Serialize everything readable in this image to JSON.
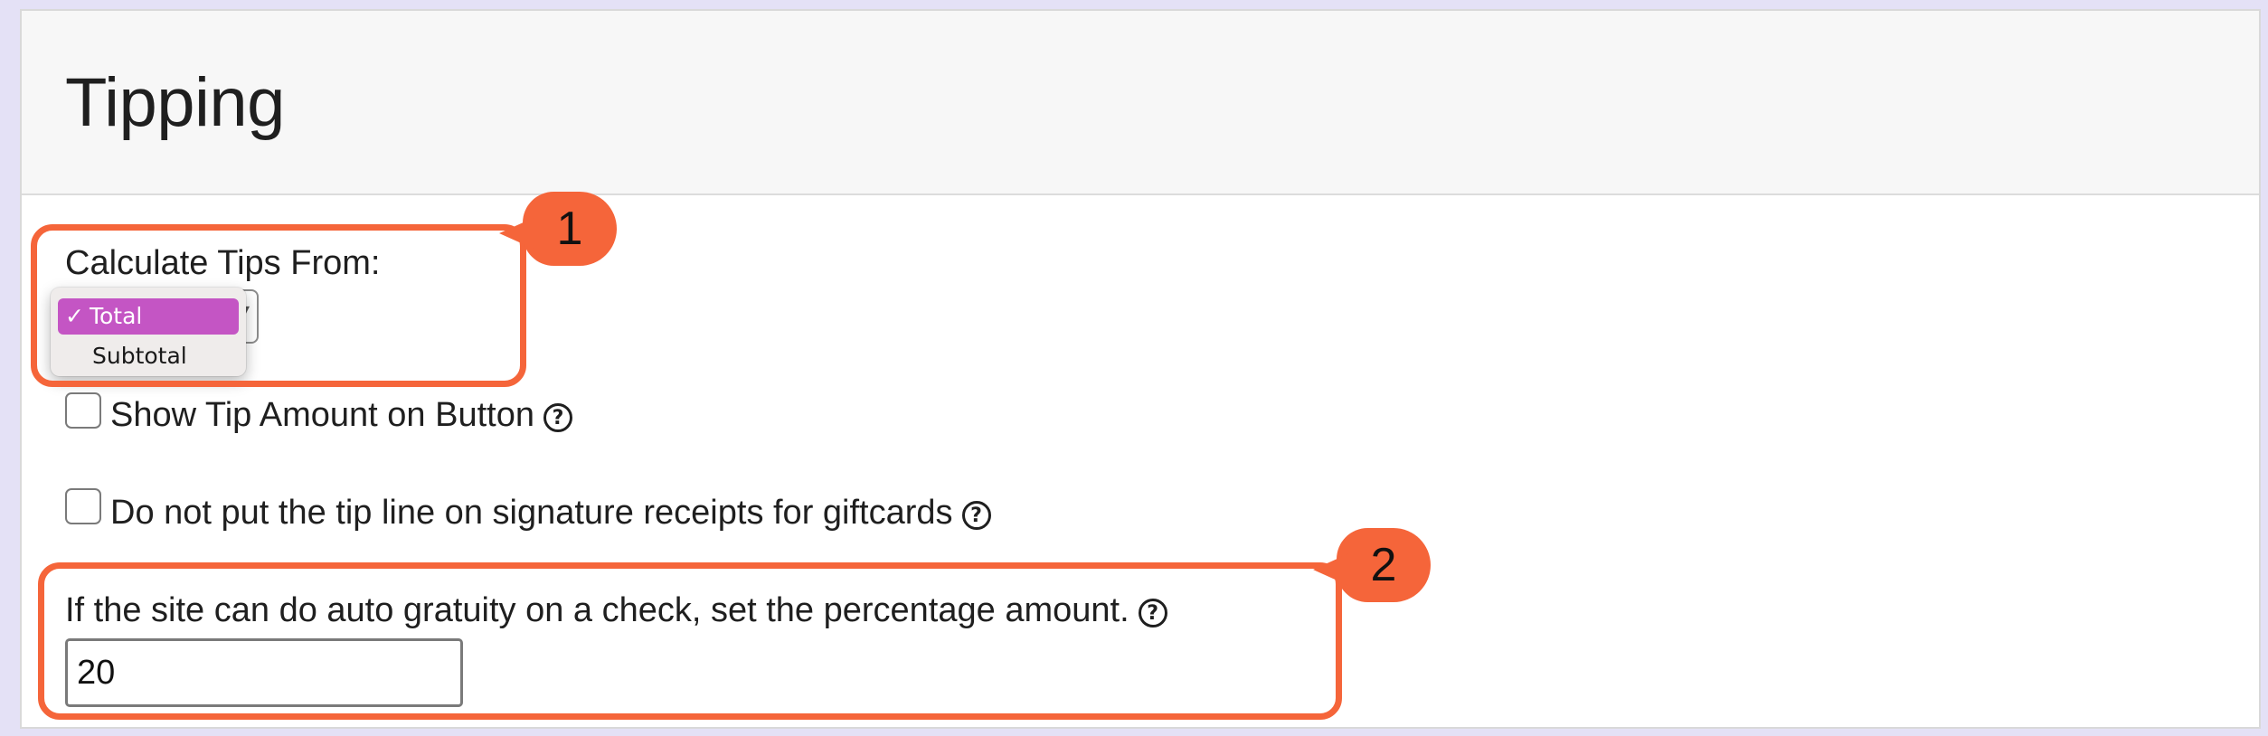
{
  "page": {
    "title": "Tipping"
  },
  "calculate_tips": {
    "label": "Calculate Tips From:",
    "options": [
      {
        "label": "Total",
        "selected": true
      },
      {
        "label": "Subtotal",
        "selected": false
      }
    ],
    "check_mark": "✓"
  },
  "show_tip_amount": {
    "label": "Show Tip Amount on Button",
    "checked": false
  },
  "no_tip_line_giftcards": {
    "label": "Do not put the tip line on signature receipts for giftcards",
    "checked": false
  },
  "auto_gratuity": {
    "label": "If the site can do auto gratuity on a check, set the percentage amount.",
    "value": "20"
  },
  "help_glyph": "?",
  "callouts": [
    {
      "number": "1"
    },
    {
      "number": "2"
    }
  ],
  "colors": {
    "accent_callout": "#f5653a",
    "selected_option": "#c455c4",
    "background": "#e4e1f6",
    "header_background": "#f7f7f7"
  },
  "icons": {
    "help": "question-circle-icon",
    "checkmark": "checkmark-icon",
    "select_caret": "chevron-updown-icon"
  }
}
